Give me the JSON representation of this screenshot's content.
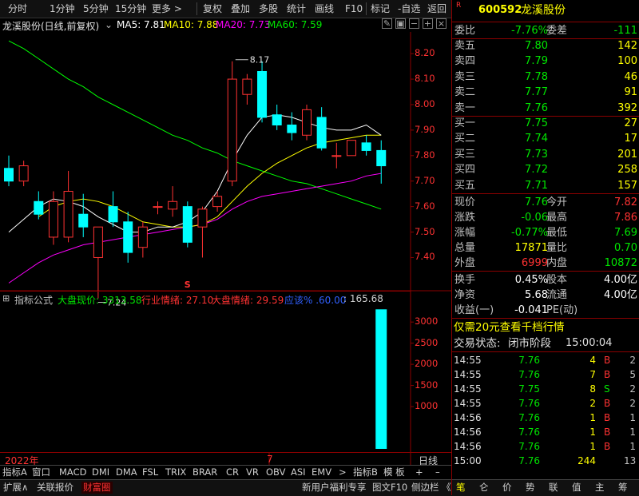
{
  "topbar": {
    "items": [
      "分时",
      "1分钟",
      "5分钟",
      "15分钟",
      "更多 >",
      "复权",
      "叠加",
      "多股",
      "统计",
      "画线",
      "F10",
      "标记",
      "-自选",
      "返回"
    ]
  },
  "title": {
    "name": "龙溪股份(日线,前复权)",
    "ma5": "MA5: 7.81",
    "ma10": "MA10: 7.88",
    "ma20": "MA20: 7.73",
    "ma60": "MA60: 7.59"
  },
  "price_axis": [
    "8.20",
    "8.10",
    "8.00",
    "7.90",
    "7.80",
    "7.70",
    "7.60",
    "7.50",
    "7.40"
  ],
  "annotations": {
    "high": "8.17",
    "low": "7.24",
    "signal": "S"
  },
  "indicator": {
    "name": "指标公式",
    "market": "大盘现价: 3313.58",
    "sector": "行业情绪: 27.10",
    "mood": "大盘情绪: 29.59",
    "pct": "应该% .60.00",
    "extra": ": 165.68"
  },
  "volume_axis": [
    "3000",
    "2500",
    "2000",
    "1500",
    "1000"
  ],
  "time_axis": {
    "year": "2022年",
    "month": "7",
    "right": "日线"
  },
  "tabs": [
    "指标A",
    "窗口",
    "MACD",
    "DMI",
    "DMA",
    "FSL",
    "TRIX",
    "BRAR",
    "CR",
    "VR",
    "OBV",
    "ASI",
    "EMV",
    ">",
    "指标B",
    "模 板",
    "+",
    "–"
  ],
  "bottom_tabs": [
    "扩展∧",
    "关联报价",
    "财富圈",
    "新用户福利专享",
    "图文F10",
    "侧边栏 《"
  ],
  "bottom_icons": [
    "笔",
    "仑",
    "价",
    "势",
    "联",
    "值",
    "主",
    "筹"
  ],
  "stock": {
    "badge": "R",
    "code": "600592",
    "name": "龙溪股份"
  },
  "order_book_head": {
    "l1": "委比",
    "v1": "-7.76%",
    "l2": "委差",
    "v2": "-111"
  },
  "asks": [
    {
      "label": "卖五",
      "price": "7.80",
      "vol": "142"
    },
    {
      "label": "卖四",
      "price": "7.79",
      "vol": "100"
    },
    {
      "label": "卖三",
      "price": "7.78",
      "vol": "46"
    },
    {
      "label": "卖二",
      "price": "7.77",
      "vol": "91"
    },
    {
      "label": "卖一",
      "price": "7.76",
      "vol": "392"
    }
  ],
  "bids": [
    {
      "label": "买一",
      "price": "7.75",
      "vol": "27"
    },
    {
      "label": "买二",
      "price": "7.74",
      "vol": "17"
    },
    {
      "label": "买三",
      "price": "7.73",
      "vol": "201"
    },
    {
      "label": "买四",
      "price": "7.72",
      "vol": "258"
    },
    {
      "label": "买五",
      "price": "7.71",
      "vol": "157"
    }
  ],
  "quote": [
    {
      "l1": "现价",
      "v1": "7.76",
      "l2": "今开",
      "v2": "7.82"
    },
    {
      "l1": "涨跌",
      "v1": "-0.06",
      "l2": "最高",
      "v2": "7.86"
    },
    {
      "l1": "涨幅",
      "v1": "-0.77%",
      "l2": "最低",
      "v2": "7.69"
    },
    {
      "l1": "总量",
      "v1": "17871",
      "l2": "量比",
      "v2": "0.70"
    },
    {
      "l1": "外盘",
      "v1": "6999",
      "l2": "内盘",
      "v2": "10872"
    }
  ],
  "fund": [
    {
      "l1": "换手",
      "v1": "0.45%",
      "l2": "股本",
      "v2": "4.00亿"
    },
    {
      "l1": "净资",
      "v1": "5.68",
      "l2": "流通",
      "v2": "4.00亿"
    },
    {
      "l1": "收益(一)",
      "v1": "-0.041",
      "l2": "PE(动)",
      "v2": ""
    }
  ],
  "promo": "仅需20元查看千档行情",
  "trade_status": {
    "label": "交易状态:",
    "value": "闭市阶段",
    "time": "15:00:04"
  },
  "ticks": [
    {
      "time": "14:55",
      "price": "7.76",
      "vol": "4",
      "side": "B",
      "n": "2"
    },
    {
      "time": "14:55",
      "price": "7.76",
      "vol": "7",
      "side": "B",
      "n": "5"
    },
    {
      "time": "14:55",
      "price": "7.75",
      "vol": "8",
      "side": "S",
      "n": "2"
    },
    {
      "time": "14:55",
      "price": "7.76",
      "vol": "2",
      "side": "B",
      "n": "2"
    },
    {
      "time": "14:56",
      "price": "7.76",
      "vol": "1",
      "side": "B",
      "n": "1"
    },
    {
      "time": "14:56",
      "price": "7.76",
      "vol": "1",
      "side": "B",
      "n": "1"
    },
    {
      "time": "14:56",
      "price": "7.76",
      "vol": "1",
      "side": "B",
      "n": "1"
    },
    {
      "time": "15:00",
      "price": "7.76",
      "vol": "244",
      "side": "",
      "n": "13"
    }
  ],
  "chart_data": {
    "type": "candlestick",
    "ylim": [
      7.32,
      8.26
    ],
    "candles": [
      {
        "o": 7.75,
        "h": 7.8,
        "l": 7.68,
        "c": 7.7
      },
      {
        "o": 7.7,
        "h": 7.78,
        "l": 7.68,
        "c": 7.76
      },
      {
        "o": 7.62,
        "h": 7.66,
        "l": 7.55,
        "c": 7.57
      },
      {
        "o": 7.48,
        "h": 7.66,
        "l": 7.45,
        "c": 7.62
      },
      {
        "o": 7.48,
        "h": 7.74,
        "l": 7.46,
        "c": 7.66
      },
      {
        "o": 7.57,
        "h": 7.65,
        "l": 7.48,
        "c": 7.52
      },
      {
        "o": 7.4,
        "h": 7.5,
        "l": 7.24,
        "c": 7.52
      },
      {
        "o": 7.6,
        "h": 7.66,
        "l": 7.52,
        "c": 7.54
      },
      {
        "o": 7.54,
        "h": 7.58,
        "l": 7.38,
        "c": 7.42
      },
      {
        "o": 7.44,
        "h": 7.54,
        "l": 7.4,
        "c": 7.52
      },
      {
        "o": 7.6,
        "h": 7.62,
        "l": 7.57,
        "c": 7.6
      },
      {
        "o": 7.59,
        "h": 7.68,
        "l": 7.56,
        "c": 7.62
      },
      {
        "o": 7.6,
        "h": 7.62,
        "l": 7.44,
        "c": 7.46
      },
      {
        "o": 7.52,
        "h": 7.6,
        "l": 7.4,
        "c": 7.59
      },
      {
        "o": 7.6,
        "h": 7.66,
        "l": 7.58,
        "c": 7.64
      },
      {
        "o": 7.7,
        "h": 8.17,
        "l": 7.68,
        "c": 8.1
      },
      {
        "o": 8.04,
        "h": 8.12,
        "l": 8.0,
        "c": 8.1
      },
      {
        "o": 8.13,
        "h": 8.17,
        "l": 7.93,
        "c": 7.95
      },
      {
        "o": 7.96,
        "h": 8.0,
        "l": 7.9,
        "c": 7.92
      },
      {
        "o": 7.92,
        "h": 7.97,
        "l": 7.86,
        "c": 7.89
      },
      {
        "o": 7.88,
        "h": 8.0,
        "l": 7.86,
        "c": 7.98
      },
      {
        "o": 7.95,
        "h": 7.99,
        "l": 7.82,
        "c": 7.83
      },
      {
        "o": 7.8,
        "h": 7.85,
        "l": 7.75,
        "c": 7.8
      },
      {
        "o": 7.8,
        "h": 7.86,
        "l": 7.8,
        "c": 7.86
      },
      {
        "o": 7.85,
        "h": 7.88,
        "l": 7.8,
        "c": 7.82
      },
      {
        "o": 7.82,
        "h": 7.86,
        "l": 7.69,
        "c": 7.76
      }
    ],
    "ma5": [
      7.5,
      7.55,
      7.6,
      7.63,
      7.62,
      7.6,
      7.56,
      7.53,
      7.5,
      7.5,
      7.52,
      7.52,
      7.54,
      7.58,
      7.66,
      7.78,
      7.88,
      7.95,
      7.96,
      7.95,
      7.93,
      7.91,
      7.9,
      7.9,
      7.92,
      7.88
    ],
    "ma10": [
      null,
      null,
      7.56,
      7.6,
      7.62,
      7.63,
      7.62,
      7.6,
      7.57,
      7.54,
      7.53,
      7.52,
      7.52,
      7.53,
      7.56,
      7.62,
      7.68,
      7.73,
      7.77,
      7.8,
      7.83,
      7.85,
      7.86,
      7.87,
      7.88,
      7.88
    ],
    "ma20": [
      7.3,
      7.34,
      7.38,
      7.41,
      7.43,
      7.45,
      7.46,
      7.47,
      7.48,
      7.49,
      7.5,
      7.51,
      7.52,
      7.53,
      7.55,
      7.59,
      7.62,
      7.64,
      7.65,
      7.66,
      7.67,
      7.68,
      7.69,
      7.7,
      7.72,
      7.73
    ],
    "ma60": [
      8.25,
      8.22,
      8.18,
      8.14,
      8.1,
      8.07,
      8.03,
      8.0,
      7.97,
      7.94,
      7.91,
      7.88,
      7.86,
      7.83,
      7.81,
      7.78,
      7.76,
      7.74,
      7.72,
      7.7,
      7.69,
      7.67,
      7.65,
      7.63,
      7.61,
      7.59
    ],
    "volume_last": 3300
  },
  "colors": {
    "up": "#ff3232",
    "down": "#00ffff",
    "ma5": "#ffffff",
    "ma10": "#ffff00",
    "ma20": "#ff00ff",
    "ma60": "#00ff00",
    "grid": "#8b0000"
  }
}
